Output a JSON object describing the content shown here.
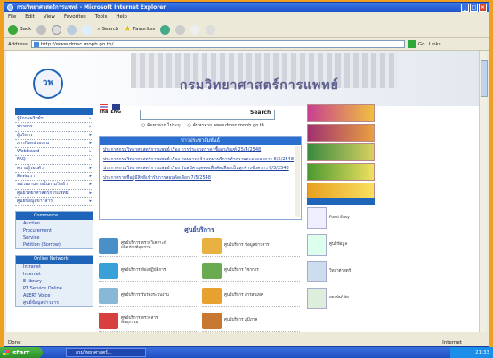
{
  "window": {
    "title": "กรมวิทยาศาสตร์การแพทย์ - Microsoft Internet Explorer"
  },
  "menu": [
    "File",
    "Edit",
    "View",
    "Favorites",
    "Tools",
    "Help"
  ],
  "toolbar": {
    "back": "Back",
    "search": "Search",
    "favorites": "Favorites"
  },
  "address": {
    "label": "Address",
    "url": "http://www.dmsc.moph.go.th/",
    "go": "Go",
    "links": "Links"
  },
  "site": {
    "title": "กรมวิทยาศาสตร์การแพทย์",
    "logo_text": "วพ"
  },
  "lang": {
    "tha": "Tha",
    "eng": "ENG"
  },
  "search": {
    "button": "Search",
    "opt1": "ค้นหาจาก ไม่ระบุ",
    "opt2": "ค้นหาจาก www.dmsc.moph.go.th"
  },
  "news": {
    "title": "ข่าวประชาสัมพันธ์",
    "items": [
      "ประกาศกรมวิทยาศาสตร์การแพทย์ เรื่อง การประกวดราคาซื้อครุภัณฑ์ 25/4/2548",
      "ประกาศกรมวิทยาศาสตร์การแพทย์ เรื่อง สอบราคาจ้างเหมาบริการทำความสะอาดอาคาร 6/5/2548",
      "ประกาศกรมวิทยาศาสตร์การแพทย์ เรื่อง รับสมัครบุคคลเพื่อคัดเลือกเป็นลูกจ้างชั่วคราว 6/5/2548",
      "ประกาศรายชื่อผู้มีสิทธิเข้ารับการสอบคัดเลือก 7/5/2548"
    ]
  },
  "services": {
    "title": "ศูนย์บริการ",
    "items": [
      "ศูนย์บริการ ตรวจวิเคราะห์ผลิตภัณฑ์สุขภาพ",
      "ศูนย์บริการ ข้อมูลข่าวสาร",
      "ศูนย์บริการ ห้องปฏิบัติการ",
      "ศูนย์บริการ วิชาการ",
      "ศูนย์บริการ รับรองระบบงาน",
      "ศูนย์บริการ สารสนเทศ",
      "ศูนย์บริการ ตรวจสารพันธุกรรม",
      "ศูนย์บริการ ภูมิภาค"
    ]
  },
  "leftnav": [
    "รู้จักกรมวิทย์ฯ",
    "ข่าวสาร",
    "ผู้บริหาร",
    "ภารกิจหน่วยงาน",
    "Webboard",
    "FAQ",
    "ความรู้รอบตัว",
    "ติดต่อเรา",
    "หน่วยงานภายในกรมวิทย์ฯ",
    "ศูนย์วิทยาศาสตร์การแพทย์",
    "ศูนย์ข้อมูลข่าวสาร"
  ],
  "panel1": {
    "title": "Commerce",
    "items": [
      "Auction",
      "Procurement",
      "Service",
      "Petition (Borrow)"
    ]
  },
  "panel2": {
    "title": "Online Network",
    "items": [
      "Intranet",
      "Internet",
      "E-library",
      "PT Service Online",
      "ALERT Voice",
      "ศูนย์ข้อมูลข่าวสาร"
    ]
  },
  "right": {
    "items": [
      "Food Easy",
      "ศูนย์ข้อมูล",
      "วิทยาศาสตร์",
      "สถาบันวิจัย"
    ]
  },
  "status": {
    "text": "Done",
    "zone": "Internet"
  },
  "taskbar": {
    "start": "start",
    "task": "กรมวิทยาศาสตร์...",
    "time": "21:33"
  }
}
